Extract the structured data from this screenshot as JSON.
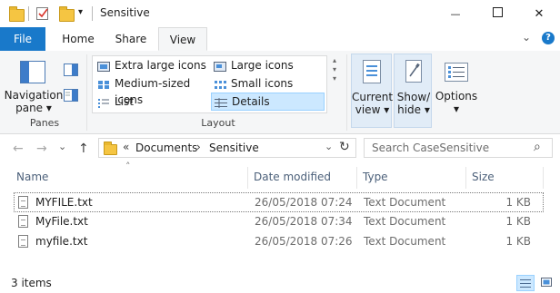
{
  "window": {
    "title": "Sensitive",
    "minimize_glyph": "—",
    "maximize_glyph": "☐",
    "close_glyph": "✕"
  },
  "quick_access": {
    "dropdown_glyph": "▾"
  },
  "ribbon": {
    "tabs": [
      {
        "label": "File"
      },
      {
        "label": "Home"
      },
      {
        "label": "Share"
      },
      {
        "label": "View"
      }
    ],
    "expand_glyph": "⌄",
    "help_glyph": "?",
    "panes": {
      "navigation_pane": {
        "line1": "Navigation",
        "line2": "pane ▾"
      },
      "group_label": "Panes"
    },
    "layout": {
      "items": [
        {
          "label": "Extra large icons"
        },
        {
          "label": "Large icons"
        },
        {
          "label": "Medium-sized icons"
        },
        {
          "label": "Small icons"
        },
        {
          "label": "List"
        },
        {
          "label": "Details"
        }
      ],
      "group_label": "Layout"
    },
    "current_view": {
      "line1": "Current",
      "line2": "view ▾"
    },
    "show_hide": {
      "line1": "Show/",
      "line2": "hide ▾"
    },
    "options": {
      "line1": "Options",
      "line2": "▾"
    }
  },
  "navigation": {
    "back_glyph": "←",
    "forward_glyph": "→",
    "recent_glyph": "⌄",
    "up_glyph": "↑",
    "breadcrumb": {
      "overflow": "«",
      "items": [
        "Documents",
        "Sensitive"
      ],
      "separator": "›"
    },
    "dropdown_glyph": "⌄",
    "refresh_glyph": "↻",
    "search_placeholder": "Search CaseSensitive",
    "search_glyph": "⌕"
  },
  "columns": {
    "sort_glyph": "˄",
    "name": "Name",
    "date_modified": "Date modified",
    "type": "Type",
    "size": "Size"
  },
  "files": [
    {
      "name": "MYFILE.txt",
      "date": "26/05/2018 07:24",
      "type": "Text Document",
      "size": "1 KB",
      "selected": true
    },
    {
      "name": "MyFile.txt",
      "date": "26/05/2018 07:34",
      "type": "Text Document",
      "size": "1 KB",
      "selected": false
    },
    {
      "name": "myfile.txt",
      "date": "26/05/2018 07:26",
      "type": "Text Document",
      "size": "1 KB",
      "selected": false
    }
  ],
  "status": {
    "item_count": "3 items"
  },
  "colors": {
    "accent": "#1979ca",
    "selection": "#cce8ff",
    "folder": "#f5c542"
  }
}
